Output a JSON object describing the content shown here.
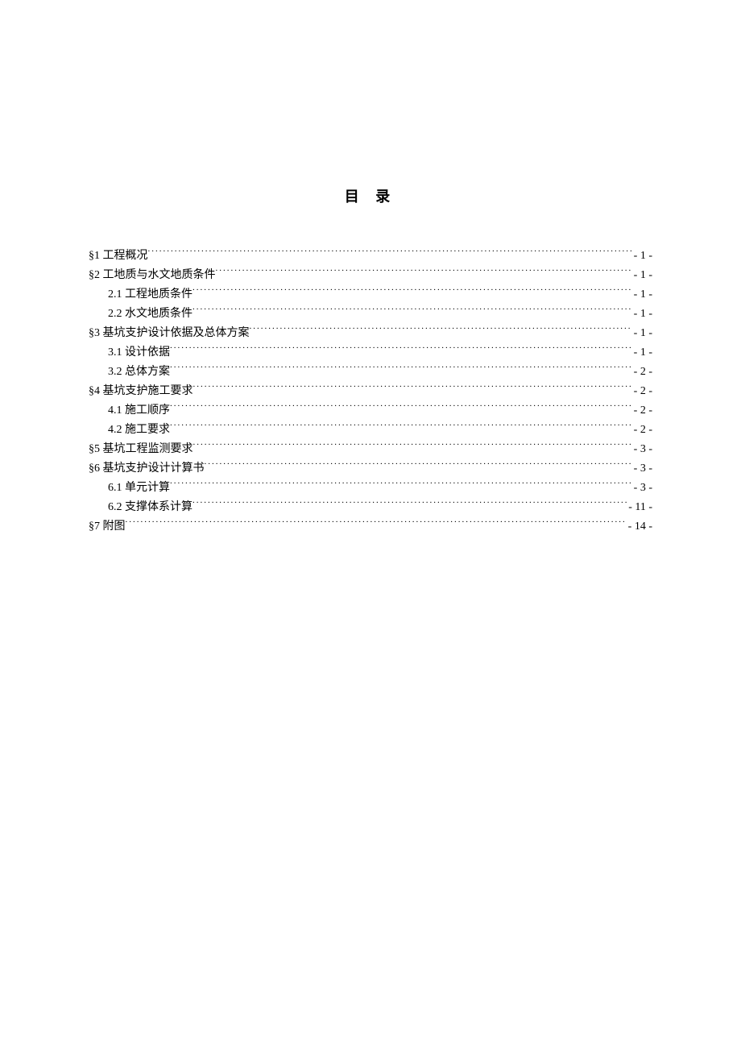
{
  "title": "目 录",
  "toc": [
    {
      "level": 1,
      "label": "§1 工程概况",
      "page": "- 1 -"
    },
    {
      "level": 1,
      "label": "§2 工地质与水文地质条件",
      "page": "- 1 -"
    },
    {
      "level": 2,
      "label": "2.1 工程地质条件",
      "page": "- 1 -"
    },
    {
      "level": 2,
      "label": "2.2 水文地质条件",
      "page": "- 1 -"
    },
    {
      "level": 1,
      "label": "§3 基坑支护设计依据及总体方案",
      "page": "- 1 -"
    },
    {
      "level": 2,
      "label": "3.1 设计依据",
      "page": "- 1 -"
    },
    {
      "level": 2,
      "label": "3.2 总体方案",
      "page": "- 2 -"
    },
    {
      "level": 1,
      "label": "§4 基坑支护施工要求",
      "page": "- 2 -"
    },
    {
      "level": 2,
      "label": "4.1 施工顺序",
      "page": "- 2 -"
    },
    {
      "level": 2,
      "label": "4.2 施工要求",
      "page": "- 2 -"
    },
    {
      "level": 1,
      "label": "§5 基坑工程监测要求",
      "page": "- 3 -"
    },
    {
      "level": 1,
      "label": "§6 基坑支护设计计算书",
      "page": "- 3 -"
    },
    {
      "level": 2,
      "label": "6.1 单元计算",
      "page": "- 3 -"
    },
    {
      "level": 2,
      "label": "6.2 支撑体系计算",
      "page": "- 11 -"
    },
    {
      "level": 1,
      "label": "§7 附图",
      "page": "- 14 -"
    }
  ]
}
